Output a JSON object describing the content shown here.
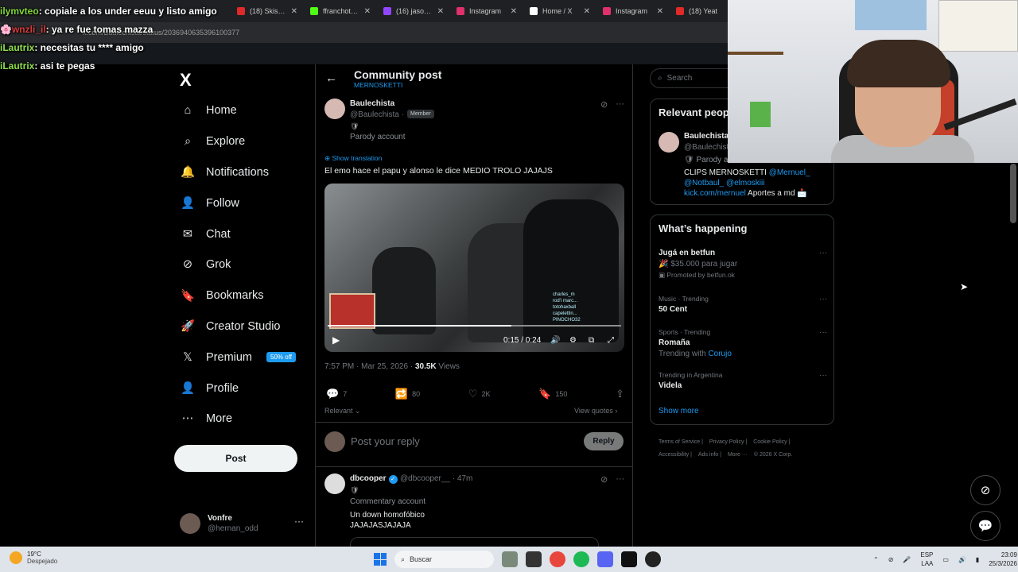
{
  "browser": {
    "tabs": [
      {
        "label": "(18) Skisia2",
        "color": "#e02929"
      },
      {
        "label": "ffranchota S",
        "color": "#53fc18"
      },
      {
        "label": "(16) jasonth",
        "color": "#9146ff"
      },
      {
        "label": "Instagram",
        "color": "#e1306c"
      },
      {
        "label": "Home / X",
        "color": "#ffffff"
      },
      {
        "label": "Instagram",
        "color": "#e1306c"
      },
      {
        "label": "(18) Yeat",
        "color": "#e02929"
      }
    ],
    "url": "x.com/Baulechista/status/2036940635396100377"
  },
  "stream_chat": [
    {
      "user": "ilymvteo",
      "message": ": copiale a los under eeuu y listo amigo"
    },
    {
      "user": "wnzli_il",
      "message": ": ya re fue tomas mazza"
    },
    {
      "user": "iLautrix",
      "message": ": necesitas tu **** amigo"
    },
    {
      "user": "iLautrix",
      "message": ": asi te pegas"
    }
  ],
  "nav": {
    "logo": "X",
    "items": [
      {
        "label": "Home",
        "icon": "home-icon",
        "glyph": "⌂"
      },
      {
        "label": "Explore",
        "icon": "search-icon",
        "glyph": "⌕"
      },
      {
        "label": "Notifications",
        "icon": "bell-icon",
        "glyph": "🔔"
      },
      {
        "label": "Follow",
        "icon": "add-user-icon",
        "glyph": "👤"
      },
      {
        "label": "Chat",
        "icon": "mail-icon",
        "glyph": "✉"
      },
      {
        "label": "Grok",
        "icon": "grok-icon",
        "glyph": "⊘"
      },
      {
        "label": "Bookmarks",
        "icon": "bookmark-icon",
        "glyph": "🔖"
      },
      {
        "label": "Creator Studio",
        "icon": "rocket-icon",
        "glyph": "🚀"
      },
      {
        "label": "Premium",
        "icon": "x-premium-icon",
        "glyph": "𝕏",
        "badge": "50% off"
      },
      {
        "label": "Profile",
        "icon": "profile-icon",
        "glyph": "👤"
      },
      {
        "label": "More",
        "icon": "more-circle-icon",
        "glyph": "⋯"
      }
    ],
    "post_label": "Post",
    "account": {
      "name": "Vonfre",
      "handle": "@hernan_odd"
    }
  },
  "header": {
    "back": "←",
    "title": "Community post",
    "subtitle": "MERNOSKETTI"
  },
  "post": {
    "name": "Baulechista",
    "handle": "@Baulechista ·",
    "member_badge": "Member",
    "shield": "🛡",
    "description": "Parody account",
    "show_translation": "Show translation",
    "text": "El emo hace el papu y alonso le dice MEDIO TROLO JAJAJS",
    "video": {
      "time": "0:15 / 0:24",
      "progress": 0.625,
      "overlay_lines": [
        "charles_m",
        "rod'i marc...",
        "totohaxball",
        "capelettin...",
        "PINOCHO32"
      ]
    },
    "timestamp": "7:57 PM · Mar 25, 2026 ·",
    "views_count": "30.5K",
    "views_label": "Views",
    "actions": [
      {
        "icon": "reply-icon",
        "glyph": "💬",
        "count": "7"
      },
      {
        "icon": "repost-icon",
        "glyph": "🔁",
        "count": "80"
      },
      {
        "icon": "like-icon",
        "glyph": "♡",
        "count": "2K"
      },
      {
        "icon": "bookmark-icon",
        "glyph": "🔖",
        "count": "150"
      },
      {
        "icon": "share-icon",
        "glyph": "⇪",
        "count": ""
      }
    ],
    "relevant": "Relevant ⌄",
    "view_quotes": "View quotes ›"
  },
  "reply_box": {
    "placeholder": "Post your reply",
    "button": "Reply"
  },
  "comment": {
    "name": "dbcooper",
    "handle": "@dbcooper__ · 47m",
    "shield": "🛡",
    "description": "Commentary account",
    "text1": "Un down homofóbico",
    "text2": "JAJAJASJAJAJA"
  },
  "right": {
    "search_placeholder": "Search",
    "relevant_title": "Relevant people",
    "relevant_person": {
      "name": "Baulechista",
      "handle": "@Baulechista",
      "desc": "🛡 Parody account",
      "bio1": "CLIPS MERNOSKETTI ",
      "bio1_link": "@Mernuel_",
      "bio2": "@Notbaul_ @elmoskiii",
      "bio3_link": "kick.com/mernuel",
      "bio3": " Aportes a md 📩"
    },
    "happening_title": "What’s happening",
    "trends": [
      {
        "small": "",
        "big": "Jugá en betfun",
        "sub": "🎉 $35.000 para jugar",
        "extra": "▣ Promoted by betfun.ok"
      },
      {
        "small": "Music · Trending",
        "big": "50 Cent",
        "sub": "",
        "extra": ""
      },
      {
        "small": "Sports · Trending",
        "big": "Romaña",
        "sub": "Trending with ",
        "sub_link": "Corujo",
        "extra": ""
      },
      {
        "small": "Trending in Argentina",
        "big": "Videla",
        "sub": "",
        "extra": ""
      }
    ],
    "show_more": "Show more",
    "footer": [
      "Terms of Service |",
      "Privacy Policy |",
      "Cookie Policy |",
      "Accessibility |",
      "Ads info |",
      "More ···",
      "© 2026 X Corp."
    ]
  },
  "taskbar": {
    "temp": "19°C",
    "weather": "Despejado",
    "search": "Buscar",
    "lang1": "ESP",
    "lang2": "LAA",
    "time": "23:09",
    "date": "25/3/2026"
  }
}
